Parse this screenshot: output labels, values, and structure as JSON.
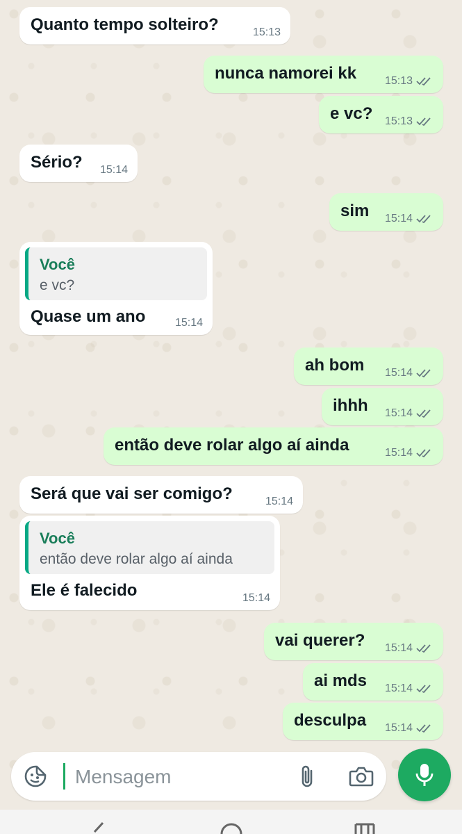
{
  "messages": [
    {
      "text": "Quanto tempo solteiro?",
      "time": "15:13"
    },
    {
      "text": "nunca namorei kk",
      "time": "15:13"
    },
    {
      "text": "e vc?",
      "time": "15:13"
    },
    {
      "text": "Sério?",
      "time": "15:14"
    },
    {
      "text": "sim",
      "time": "15:14"
    },
    {
      "quote_author": "Você",
      "quote_text": "e vc?",
      "text": "Quase um ano",
      "time": "15:14"
    },
    {
      "text": "ah bom",
      "time": "15:14"
    },
    {
      "text": "ihhh",
      "time": "15:14"
    },
    {
      "text": "então deve rolar algo aí ainda",
      "time": "15:14"
    },
    {
      "text": "Será que vai ser comigo?",
      "time": "15:14"
    },
    {
      "quote_author": "Você",
      "quote_text": "então deve rolar algo aí ainda",
      "text": "Ele é falecido",
      "time": "15:14"
    },
    {
      "text": "vai querer?",
      "time": "15:14"
    },
    {
      "text": "ai mds",
      "time": "15:14"
    },
    {
      "text": "desculpa",
      "time": "15:14"
    }
  ],
  "composer": {
    "placeholder": "Mensagem",
    "icons": [
      "sticker-icon",
      "paperclip-icon",
      "camera-icon",
      "microphone-icon"
    ]
  },
  "colors": {
    "outgoing_bubble": "#d9fdd3",
    "incoming_bubble": "#ffffff",
    "accent": "#1daa61",
    "quote_author": "#1a7e5a",
    "wallpaper": "#efeae2"
  }
}
